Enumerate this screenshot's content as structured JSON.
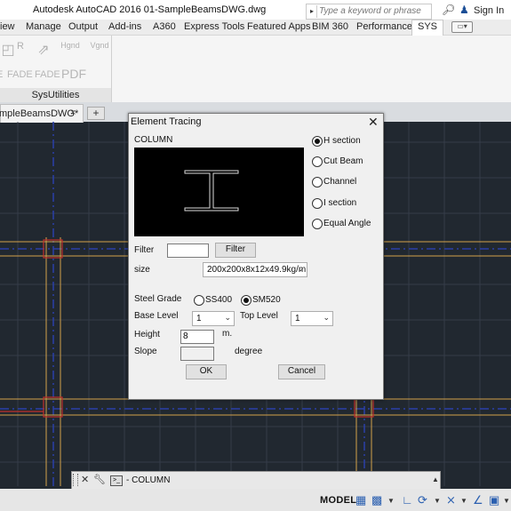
{
  "window": {
    "title": "Autodesk AutoCAD 2016   01-SampleBeamsDWG.dwg",
    "search_placeholder": "Type a keyword or phrase",
    "sign_in": "Sign In"
  },
  "ribbon_tabs": [
    "iew",
    "Manage",
    "Output",
    "Add-ins",
    "A360",
    "Express Tools",
    "Featured Apps",
    "BIM 360",
    "Performance",
    "SYS"
  ],
  "ribbon_tab_extra": "▭▾",
  "ribbon": {
    "panel_label": "SysUtilities",
    "items": [
      "E",
      "FADE",
      "FADE",
      "PDF"
    ],
    "icons": [
      "R",
      "Hgnd",
      "Vgnd"
    ]
  },
  "doc_tab": {
    "label": "mpleBeamsDWG*",
    "close": "×",
    "new_tab": "+"
  },
  "dialog": {
    "title": "Element Tracing",
    "close": "✕",
    "element_type": "COLUMN",
    "section_options": [
      {
        "label": "H section",
        "selected": true
      },
      {
        "label": "Cut Beam",
        "selected": false
      },
      {
        "label": "Channel",
        "selected": false
      },
      {
        "label": "I section",
        "selected": false
      },
      {
        "label": "Equal Angle",
        "selected": false
      }
    ],
    "filter_label": "Filter",
    "filter_value": "",
    "filter_button": "Filter",
    "size_label": "size",
    "size_value": "200x200x8x12x49.9kg/m",
    "steel_grade_label": "Steel Grade",
    "steel_grades": [
      {
        "label": "SS400",
        "selected": false
      },
      {
        "label": "SM520",
        "selected": true
      }
    ],
    "base_level_label": "Base Level",
    "base_level_value": "1",
    "top_level_label": "Top Level",
    "top_level_value": "1",
    "height_label": "Height",
    "height_value": "8",
    "height_unit": "m.",
    "slope_label": "Slope",
    "slope_value": "",
    "slope_unit": "degree",
    "ok": "OK",
    "cancel": "Cancel"
  },
  "command_line": {
    "text": "- COLUMN"
  },
  "status_bar": {
    "model": "MODEL"
  },
  "colors": {
    "canvas": "#212830",
    "grid": "#3a4250",
    "axis": "#2b3fa8",
    "beam_orange": "#d4a24a",
    "beam_red": "#c0302a"
  }
}
